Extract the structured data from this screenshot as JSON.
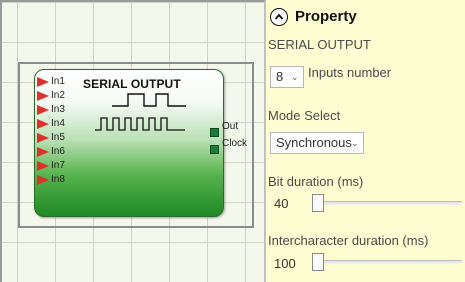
{
  "block": {
    "title": "SERIAL OUTPUT",
    "inputs": [
      "In1",
      "In2",
      "In3",
      "In4",
      "In5",
      "In6",
      "In7",
      "In8"
    ],
    "outputs": [
      "Out",
      "Clock"
    ]
  },
  "panel": {
    "title": "Property",
    "subtitle": "SERIAL OUTPUT",
    "inputs_number": {
      "value": "8",
      "label": "Inputs number"
    },
    "mode_select": {
      "label": "Mode Select",
      "value": "Synchronous"
    },
    "bit_duration": {
      "label": "Bit duration (ms)",
      "value": "40"
    },
    "intercharacter_duration": {
      "label": "Intercharacter duration (ms)",
      "value": "100"
    }
  },
  "colors": {
    "panel_bg": "#fffed2",
    "canvas_bg": "#f3f7ec",
    "block_green": "#1f8a24",
    "input_arrow": "#e0302a",
    "output_pin": "#1c7a3a"
  },
  "icons": {
    "collapse": "chevron-up-circle-icon",
    "dropdown": "chevron-down-icon"
  }
}
